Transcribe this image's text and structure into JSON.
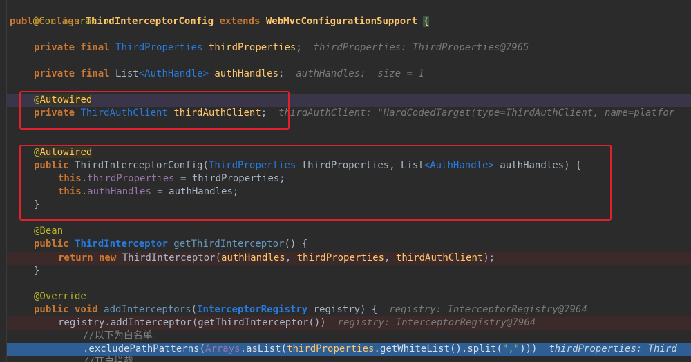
{
  "code": {
    "l1": "@Configuration",
    "l2_kw": "public class ",
    "l2_cls": "ThirdInterceptorConfig",
    "l2_ext": " extends ",
    "l2_parent": "WebMvcConfigurationSupport",
    "l2_brace": "{",
    "l4_kw": "private final ",
    "l4_type": "ThirdProperties",
    "l4_var": "thirdProperties",
    "l4_semi": ";",
    "l4_hint": "thirdProperties: ThirdProperties@7965",
    "l6_kw": "private final ",
    "l6_type": "List",
    "l6_gen": "<AuthHandle>",
    "l6_var": "authHandles",
    "l6_semi": ";",
    "l6_hint": "authHandles:  size = 1",
    "l8_at": "@",
    "l8_ann": "Autowired",
    "l9_kw": "private ",
    "l9_type": "ThirdAuthClient",
    "l9_var": "thirdAuthClient",
    "l9_semi": ";",
    "l9_hint": "thirdAuthClient: \"HardCodedTarget(type=ThirdAuthClient, name=platfor",
    "l11_at": "@",
    "l11_ann": "Autowired",
    "l12_kw": "public ",
    "l12_name": "ThirdInterceptorConfig(",
    "l12_t1": "ThirdProperties",
    "l12_p1": " thirdProperties, ",
    "l12_t2": "List",
    "l12_g2": "<AuthHandle>",
    "l12_p2": " authHandles) {",
    "l13_this": "this",
    "l13_dot": ".",
    "l13_fld": "thirdProperties",
    "l13_rest": " = thirdProperties;",
    "l14_this": "this",
    "l14_dot": ".",
    "l14_fld": "authHandles",
    "l14_rest": " = authHandles;",
    "l15": "}",
    "l16": "@Bean",
    "l17_kw": "public ",
    "l17_type": "ThirdInterceptor",
    "l17_fn": " getThirdInterceptor",
    "l17_rest": "() {",
    "l18_kw": "return new ",
    "l18_cls": "ThirdInterceptor(",
    "l18_a1": "authHandles",
    "l18_c1": ", ",
    "l18_a2": "thirdProperties",
    "l18_c2": ", ",
    "l18_a3": "thirdAuthClient",
    "l18_end": ");",
    "l19": "}",
    "l21": "@Override",
    "l22_kw": "public void ",
    "l22_fn": "addInterceptors",
    "l22_p": "(",
    "l22_type": "InterceptorRegistry",
    "l22_rest": " registry) {",
    "l22_hint": "registry: InterceptorRegistry@7964",
    "l23_code": "registry.addInterceptor(getThirdInterceptor())",
    "l23_hint": "registry: InterceptorRegistry@7964",
    "l24": "//以下为白名单",
    "l25_a": ".excludePathPatterns(",
    "l25_b": "Arrays",
    "l25_c": ".asList(",
    "l25_d": "thirdProperties",
    "l25_e": ".getWhiteList().split(",
    "l25_f": "\",\"",
    "l25_g": ")))",
    "l25_hint": "thirdProperties: Third",
    "l26": "//开启拦截"
  },
  "colors": {
    "background": "#2b2b2b",
    "current_line": "#3a3548",
    "breakpoint_line": "#3c2a2a",
    "execution_line": "#2d5f94",
    "annotation_box": "#e0202a"
  }
}
